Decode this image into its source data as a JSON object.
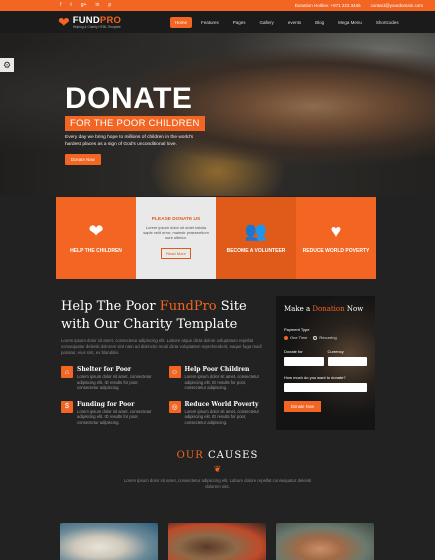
{
  "topbar": {
    "social_icons": [
      "facebook-icon",
      "twitter-icon",
      "google-plus-icon",
      "linkedin-icon",
      "pinterest-icon"
    ],
    "hotline": "Donation Hotline: +971 223 3445",
    "email": "contact@yourdomain.com"
  },
  "header": {
    "logo_fund": "FUND",
    "logo_pro": "PRO",
    "logo_tagline": "Helping & Charity HTML Template",
    "menu": [
      "Home",
      "Features",
      "Pages",
      "Gallery",
      "events",
      "Blog",
      "Mega Menu",
      "Shortcodes"
    ],
    "active_index": 0
  },
  "hero": {
    "title": "DONATE",
    "subtitle": "FOR THE POOR CHILDREN",
    "description": "Every day we bring hope to millions of children in the world's hardest places as a sign of God's unconditional love.",
    "button": "Donate Now"
  },
  "features": {
    "help_children": "HELP THE CHILDREN",
    "please_donate": "PLEASE DONATE US",
    "please_donate_text": "Lorem ipsum dolor sit amet tabula sapie velit error, maiestr praesentium sunt ulterior.",
    "read_more": "Read More",
    "volunteer": "BECOME A VOLUNTEER",
    "reduce": "REDUCE WORLD POVERTY"
  },
  "help": {
    "title_pre": "Help The Poor ",
    "title_brand": "FundPro",
    "title_post": " Site with Our Charity Template",
    "description": "Lorem ipsum dolor sit amet, consectetur adipiscing elit. Labore atque dicta dolore voluptatum repellat consequatur deleniti dolorem sint nam ad distinctio modi dicta voluptatem reprehenderit, eaque fuga modi pariatur, eius sint, ex blanditiis.",
    "services": [
      {
        "title": "Shelter for Poor",
        "text": "Lorem ipsum dolor sit amet, consectetur adipiscing elit. ID results for poor, consectetur adipiscing."
      },
      {
        "title": "Help Poor Children",
        "text": "Lorem ipsum dolor sit amet, consectetur adipiscing elit. ID results for poor, consectetur adipiscing."
      },
      {
        "title": "Funding for Poor",
        "text": "Lorem ipsum dolor sit amet, consectetur adipiscing elit. ID results for poor, consectetur adipiscing."
      },
      {
        "title": "Reduce World Poverty",
        "text": "Lorem ipsum dolor sit amet, consectetur adipiscing elit. ID results for poor, consectetur adipiscing."
      }
    ]
  },
  "donation_form": {
    "title_pre": "Make a ",
    "title_accent": "Donation",
    "title_post": " Now",
    "payment_type_label": "Payment Type",
    "one_time": "One Time",
    "recurring": "Recurring",
    "donate_for_label": "Donate for",
    "currency_label": "Currency",
    "amount_label": "How much do you want to donate?",
    "button": "Donate Now"
  },
  "causes": {
    "title_our": "OUR",
    "title_causes": "CAUSES",
    "description": "Lorem ipsum dolor sit amet, consectetur adipiscing elit. Labore dolore repellat consequatur deleniti dolorem sint."
  },
  "colors": {
    "accent": "#f26522",
    "dark": "#222222",
    "nav": "#1b1b1b"
  }
}
